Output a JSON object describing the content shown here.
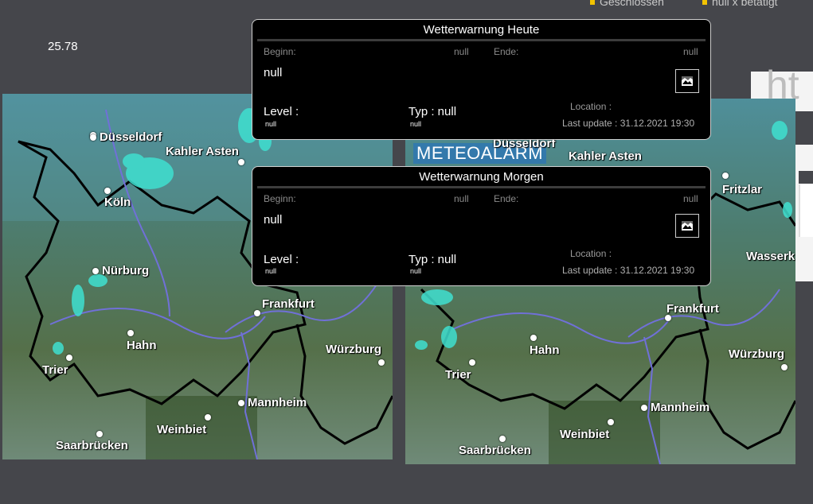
{
  "legend": {
    "closed_label": "Geschlossen",
    "null_label": "null x betätigt"
  },
  "top_value": "25.78",
  "maps": {
    "left_cities": [
      "Düsseldorf",
      "Kahler Asten",
      "Köln",
      "Nürburg",
      "Frankfurt",
      "Hahn",
      "Würzburg",
      "Trier",
      "Mannheim",
      "Weinbiet",
      "Saarbrücken"
    ],
    "right_cities": [
      "Düsseldorf",
      "Kahler Asten",
      "Fritzlar",
      "Wasserk",
      "Frankfurt",
      "Hahn",
      "Würzburg",
      "Trier",
      "Mannheim",
      "Weinbiet",
      "Saarbrücken"
    ],
    "overlay_brand": "METEOALARM"
  },
  "warnings": {
    "today": {
      "title": "Wetterwarnung Heute",
      "begin_label": "Beginn:",
      "begin_value": "null",
      "end_label": "Ende:",
      "end_value": "null",
      "text": "null",
      "level_label": "Level :",
      "level_value": "null",
      "type_label": "Typ : null",
      "type_value": "null",
      "location_label": "Location :",
      "last_update": "Last update : 31.12.2021 19:30"
    },
    "tomorrow": {
      "title": "Wetterwarnung Morgen",
      "begin_label": "Beginn:",
      "begin_value": "null",
      "end_label": "Ende:",
      "end_value": "null",
      "text": "null",
      "level_label": "Level :",
      "level_value": "null",
      "type_label": "Typ : null",
      "type_value": "null",
      "location_label": "Location :",
      "last_update": "Last update : 31.12.2021 19:30"
    }
  },
  "colors": {
    "background": "#45464b",
    "card": "#000000",
    "legend_marker": "#f2c300",
    "radar_echo": "#3fe0d0"
  },
  "icons": {
    "warning_image": "broken-image-icon"
  }
}
